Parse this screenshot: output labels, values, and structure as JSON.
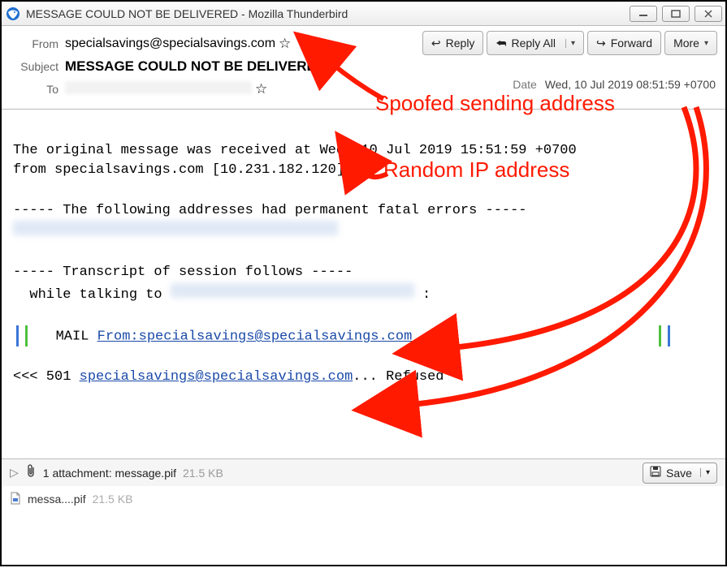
{
  "window": {
    "title": "MESSAGE COULD NOT BE DELIVERED - Mozilla Thunderbird"
  },
  "toolbar": {
    "reply": "Reply",
    "reply_all": "Reply All",
    "forward": "Forward",
    "more": "More"
  },
  "headers": {
    "from_label": "From",
    "from_value": "specialsavings@specialsavings.com",
    "subject_label": "Subject",
    "subject_value": "MESSAGE COULD NOT BE DELIVERED",
    "to_label": "To",
    "date_label": "Date",
    "date_value": "Wed, 10 Jul 2019 08:51:59 +0700"
  },
  "body": {
    "line1": "The original message was received at Wed, 10 Jul 2019 15:51:59 +0700",
    "line2a": "from specialsavings.com ",
    "line2b": "[10.231.182.120]",
    "sep1": "----- The following addresses had permanent fatal errors -----",
    "sep2": "----- Transcript of session follows -----",
    "while": "  while talking to ",
    "colon": " :",
    "mail_pre": "   MAIL ",
    "mail_link": "From:specialsavings@specialsavings.com",
    "last_pre": "<<< 501 ",
    "last_link": "specialsavings@specialsavings.com",
    "last_post": "... Refused"
  },
  "attachments": {
    "summary": "1 attachment: message.pif",
    "size": "21.5 KB",
    "save": "Save",
    "item_name": "messa....pif",
    "item_size": "21.5 KB"
  },
  "annotations": {
    "spoofed": "Spoofed sending address",
    "random_ip": "Random IP address"
  },
  "colors": {
    "anno": "#ff1a00"
  }
}
